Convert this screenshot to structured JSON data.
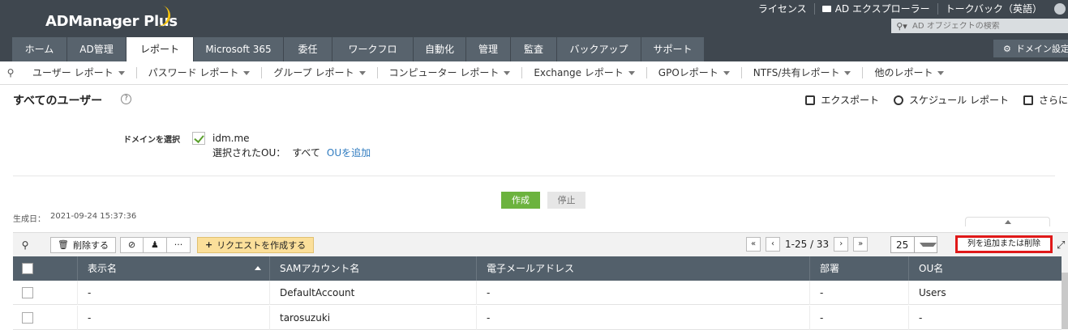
{
  "app": {
    "logo_text": "ADManager Plus",
    "top_links": [
      {
        "label": "ライセンス",
        "icon": ""
      },
      {
        "label": "AD エクスプローラー",
        "icon": "folder-icon"
      },
      {
        "label": "トークバック（英語）",
        "icon": ""
      }
    ],
    "search_placeholder": "AD オブジェクトの検索",
    "domain_settings_label": "ドメイン設定"
  },
  "nav": {
    "tabs": [
      {
        "label": "ホーム",
        "active": false
      },
      {
        "label": "AD管理",
        "active": false
      },
      {
        "label": "レポート",
        "active": true
      },
      {
        "label": "Microsoft 365",
        "active": false
      },
      {
        "label": "委任",
        "active": false
      },
      {
        "label": "ワークフロー",
        "active": false
      },
      {
        "label": "自動化",
        "active": false
      },
      {
        "label": "管理",
        "active": false
      },
      {
        "label": "監査",
        "active": false
      },
      {
        "label": "バックアップ",
        "active": false
      },
      {
        "label": "サポート",
        "active": false
      }
    ]
  },
  "subnav": {
    "items": [
      "ユーザー レポート",
      "パスワード レポート",
      "グループ レポート",
      "コンピューター レポート",
      "Exchange レポート",
      "GPOレポート",
      "NTFS/共有レポート",
      "他のレポート"
    ]
  },
  "page": {
    "title": "すべてのユーザー",
    "help": "?",
    "actions": {
      "export": "エクスポート",
      "schedule": "スケジュール レポート",
      "more": "さらに"
    }
  },
  "filter": {
    "domain_label": "ドメインを選択",
    "domain_value": "idm.me",
    "ou_label": "選択されたOU：",
    "ou_value": "すべて",
    "add_ou": "OUを追加"
  },
  "run": {
    "create": "作成",
    "stop": "停止",
    "generated_label": "生成日：",
    "generated_value": "2021-09-24 15:37:36"
  },
  "toolbar": {
    "delete": "削除する",
    "more": "···",
    "request": "リクエストを作成する",
    "page_range": "1-25 / 33",
    "page_size": "25",
    "columns": "列を追加または削除"
  },
  "table": {
    "columns": [
      "表示名",
      "SAMアカウント名",
      "電子メールアドレス",
      "部署",
      "OU名"
    ],
    "rows": [
      [
        "-",
        "DefaultAccount",
        "-",
        "-",
        "Users"
      ],
      [
        "-",
        "tarosuzuki",
        "-",
        "-",
        "-"
      ]
    ]
  },
  "colors": {
    "header_bg": "#3f474f",
    "tab_bg": "#58636d",
    "create_green": "#6cb33e",
    "request_yellow": "#fbdf9a",
    "highlight_red": "#e01919",
    "link_blue": "#2f7bbf"
  }
}
